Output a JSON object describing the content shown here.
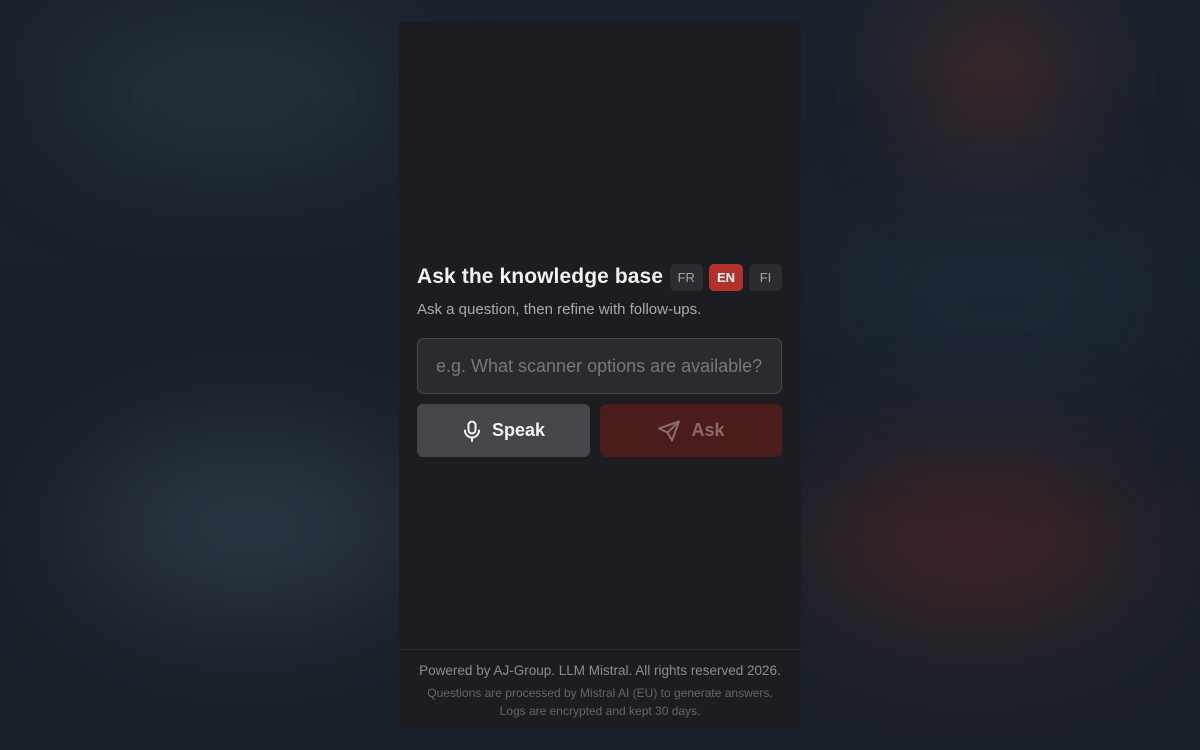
{
  "header": {
    "title": "Ask the knowledge base",
    "subtitle": "Ask a question, then refine with follow-ups."
  },
  "languages": [
    {
      "label": "FR",
      "active": false
    },
    {
      "label": "EN",
      "active": true
    },
    {
      "label": "FI",
      "active": false
    }
  ],
  "question_input": {
    "value": "",
    "placeholder": "e.g. What scanner options are available?"
  },
  "actions": {
    "speak_label": "Speak",
    "speak_icon": "microphone-icon",
    "ask_label": "Ask",
    "ask_icon": "send-icon"
  },
  "footer": {
    "line1": "Powered by AJ-Group. LLM Mistral. All rights reserved 2026.",
    "line2": "Questions are processed by Mistral AI (EU) to generate answers.",
    "line3": "Logs are encrypted and kept 30 days."
  },
  "colors": {
    "accent": "#b4302a",
    "ask_button_disabled": "#4a1c1c",
    "panel": "#1c1d20"
  }
}
